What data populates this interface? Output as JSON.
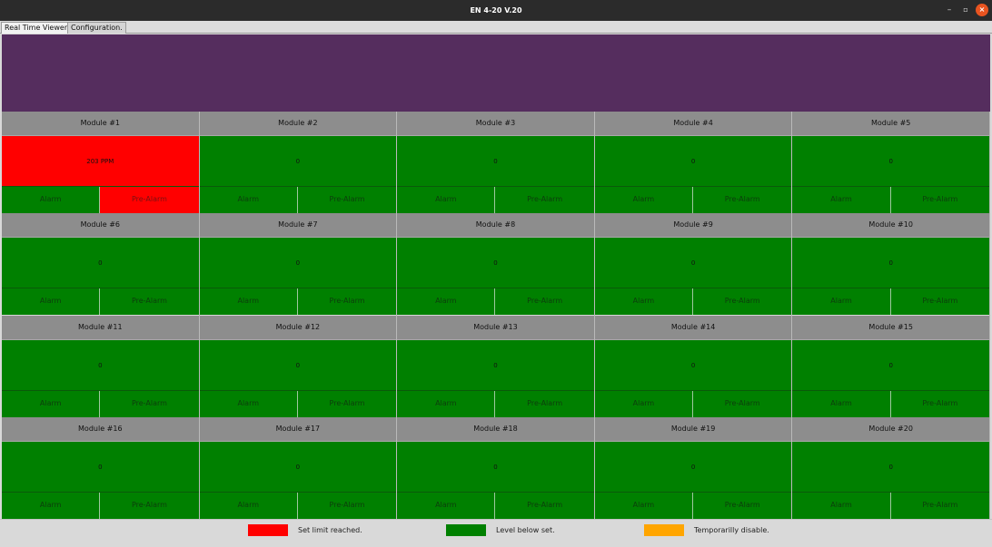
{
  "window": {
    "title": "EN 4-20 V.20",
    "min_glyph": "–",
    "max_glyph": "▫",
    "close_glyph": "×"
  },
  "tabs": [
    {
      "label": "Real Time Viewer.",
      "active": true
    },
    {
      "label": "Configuration.",
      "active": false
    }
  ],
  "modules": [
    {
      "name": "Module #1",
      "value": "203 PPM",
      "state": "alarm",
      "alarm_label": "Alarm",
      "prealarm_label": "Pre-Alarm",
      "prealarm_on": true
    },
    {
      "name": "Module #2",
      "value": "0",
      "state": "ok",
      "alarm_label": "Alarm",
      "prealarm_label": "Pre-Alarm"
    },
    {
      "name": "Module #3",
      "value": "0",
      "state": "ok",
      "alarm_label": "Alarm",
      "prealarm_label": "Pre-Alarm"
    },
    {
      "name": "Module #4",
      "value": "0",
      "state": "ok",
      "alarm_label": "Alarm",
      "prealarm_label": "Pre-Alarm"
    },
    {
      "name": "Module #5",
      "value": "0",
      "state": "ok",
      "alarm_label": "Alarm",
      "prealarm_label": "Pre-Alarm"
    },
    {
      "name": "Module #6",
      "value": "0",
      "state": "ok",
      "alarm_label": "Alarm",
      "prealarm_label": "Pre-Alarm"
    },
    {
      "name": "Module #7",
      "value": "0",
      "state": "ok",
      "alarm_label": "Alarm",
      "prealarm_label": "Pre-Alarm"
    },
    {
      "name": "Module #8",
      "value": "0",
      "state": "ok",
      "alarm_label": "Alarm",
      "prealarm_label": "Pre-Alarm"
    },
    {
      "name": "Module #9",
      "value": "0",
      "state": "ok",
      "alarm_label": "Alarm",
      "prealarm_label": "Pre-Alarm"
    },
    {
      "name": "Module #10",
      "value": "0",
      "state": "ok",
      "alarm_label": "Alarm",
      "prealarm_label": "Pre-Alarm"
    },
    {
      "name": "Module #11",
      "value": "0",
      "state": "ok",
      "alarm_label": "Alarm",
      "prealarm_label": "Pre-Alarm"
    },
    {
      "name": "Module #12",
      "value": "0",
      "state": "ok",
      "alarm_label": "Alarm",
      "prealarm_label": "Pre-Alarm"
    },
    {
      "name": "Module #13",
      "value": "0",
      "state": "ok",
      "alarm_label": "Alarm",
      "prealarm_label": "Pre-Alarm"
    },
    {
      "name": "Module #14",
      "value": "0",
      "state": "ok",
      "alarm_label": "Alarm",
      "prealarm_label": "Pre-Alarm"
    },
    {
      "name": "Module #15",
      "value": "0",
      "state": "ok",
      "alarm_label": "Alarm",
      "prealarm_label": "Pre-Alarm"
    },
    {
      "name": "Module #16",
      "value": "0",
      "state": "ok",
      "alarm_label": "Alarm",
      "prealarm_label": "Pre-Alarm"
    },
    {
      "name": "Module #17",
      "value": "0",
      "state": "ok",
      "alarm_label": "Alarm",
      "prealarm_label": "Pre-Alarm"
    },
    {
      "name": "Module #18",
      "value": "0",
      "state": "ok",
      "alarm_label": "Alarm",
      "prealarm_label": "Pre-Alarm"
    },
    {
      "name": "Module #19",
      "value": "0",
      "state": "ok",
      "alarm_label": "Alarm",
      "prealarm_label": "Pre-Alarm"
    },
    {
      "name": "Module #20",
      "value": "0",
      "state": "ok",
      "alarm_label": "Alarm",
      "prealarm_label": "Pre-Alarm"
    }
  ],
  "legend": [
    {
      "label": "Set limit reached.",
      "color": "#ff0000"
    },
    {
      "label": "Level below set.",
      "color": "#008000"
    },
    {
      "label": "Temporarilly disable.",
      "color": "#ffa500"
    }
  ]
}
